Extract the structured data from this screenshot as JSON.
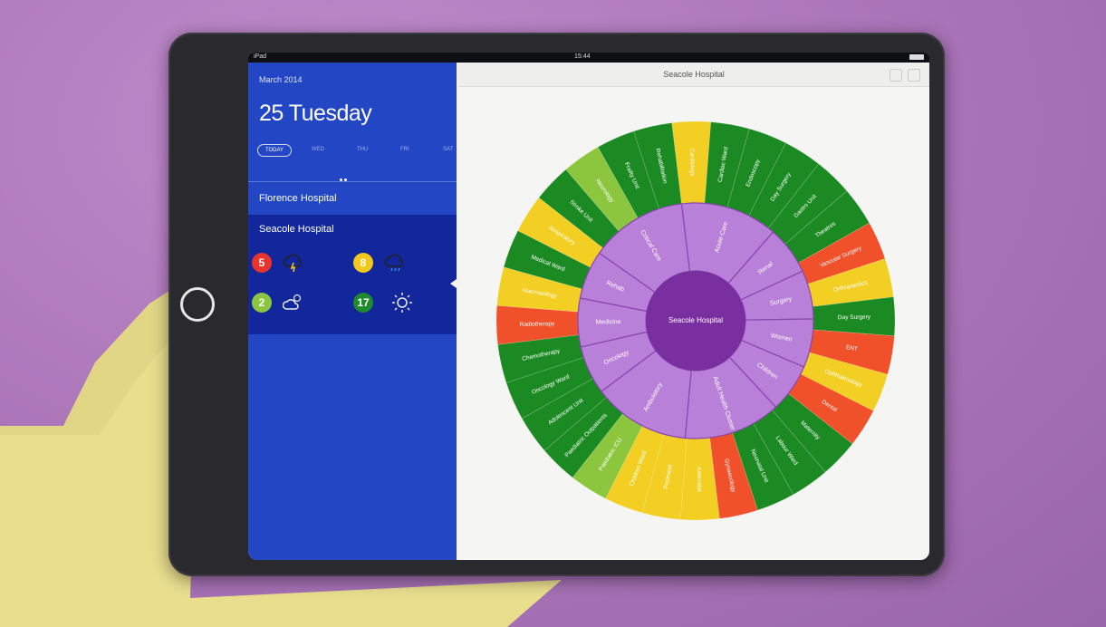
{
  "status_bar": {
    "time": "15:44",
    "carrier": "iPad"
  },
  "sidebar": {
    "month": "March 2014",
    "date": "25 Tuesday",
    "days": [
      "TODAY",
      "WED",
      "THU",
      "FRI",
      "SAT"
    ],
    "hospitals": [
      {
        "name": "Florence Hospital",
        "selected": false
      },
      {
        "name": "Seacole Hospital",
        "selected": true
      }
    ],
    "stats": [
      {
        "value": "5",
        "color": "#e8342c",
        "icon": "storm-cloud-icon"
      },
      {
        "value": "8",
        "color": "#f2c81a",
        "icon": "rain-cloud-icon"
      },
      {
        "value": "2",
        "color": "#8cc63f",
        "icon": "partly-cloudy-icon"
      },
      {
        "value": "17",
        "color": "#1f8a2e",
        "icon": "sun-icon"
      }
    ]
  },
  "detail": {
    "title": "Seacole Hospital"
  },
  "sunburst": {
    "center": "Seacole Hospital",
    "inner_color": "#b880d8",
    "center_color": "#7a2fa0",
    "colors": {
      "green": "#1c8a22",
      "red": "#f0502a",
      "yellow": "#f2cf22",
      "lime": "#8cc63f"
    },
    "inner_ring": [
      {
        "label": "Acute Care",
        "span": 2
      },
      {
        "label": "Renal",
        "span": 1
      },
      {
        "label": "Surgery",
        "span": 1
      },
      {
        "label": "Women",
        "span": 1
      },
      {
        "label": "Children",
        "span": 1
      },
      {
        "label": "Adult Health Cluster",
        "span": 2
      },
      {
        "label": "Ambulatory",
        "span": 2
      },
      {
        "label": "Oncology",
        "span": 1
      },
      {
        "label": "Medicine",
        "span": 1
      },
      {
        "label": "Rehab",
        "span": 1
      },
      {
        "label": "Critical Care",
        "span": 2
      }
    ],
    "outer_ring": [
      "yellow",
      "green",
      "green",
      "green",
      "green",
      "green",
      "red",
      "yellow",
      "green",
      "red",
      "yellow",
      "red",
      "green",
      "green",
      "green",
      "red",
      "yellow",
      "yellow",
      "yellow",
      "lime",
      "green",
      "green",
      "green",
      "green",
      "red",
      "yellow",
      "green",
      "yellow",
      "green",
      "lime",
      "green",
      "green"
    ],
    "outer_labels": [
      "Cardiology",
      "Cardiac Ward",
      "Endoscopy",
      "Day Surgery",
      "Gastro Unit",
      "Theatres",
      "Vascular Surgery",
      "Orthopaedics",
      "Day Surgery",
      "ENT",
      "Ophthalmology",
      "Dental",
      "Maternity",
      "Labour Ward",
      "Neonatal Unit",
      "Gynaecology",
      "Antenatal",
      "Postnatal",
      "Children Ward",
      "Paediatric ICU",
      "Paediatric Outpatients",
      "Adolescent Unit",
      "Oncology Ward",
      "Chemotherapy",
      "Radiotherapy",
      "Haematology",
      "Medical Ward",
      "Respiratory",
      "Stroke Unit",
      "Neurology",
      "Frailty Unit",
      "Rehabilitation"
    ]
  }
}
